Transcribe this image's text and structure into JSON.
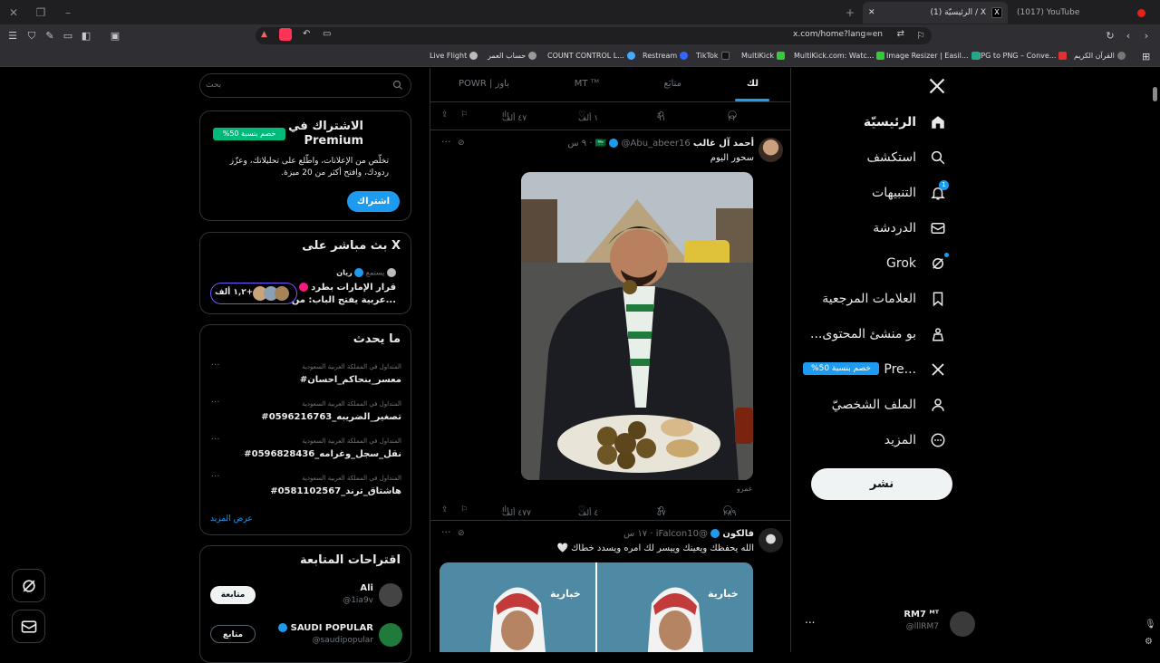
{
  "browser": {
    "tabs": [
      {
        "title": "(1017) YouTube",
        "active": false
      },
      {
        "title": "(1) الرئيسيّة / X",
        "active": true
      }
    ],
    "url": "x.com/home?lang=en",
    "bookmarks": [
      "القرآن الكريم",
      "JPG to PNG – Conve...",
      "Image Resizer | Easil...",
      "MultiKick.com: Watc...",
      "MultiKick",
      "TikTok",
      "Restream",
      "COUNT CONTROL L...",
      "حساب العمر",
      "Live Flight"
    ]
  },
  "nav": {
    "items": [
      {
        "label": "الرئيسيّة",
        "icon": "home-icon",
        "bold": true
      },
      {
        "label": "استكشف",
        "icon": "search-icon"
      },
      {
        "label": "التنبيهات",
        "icon": "bell-icon",
        "badge": "1"
      },
      {
        "label": "الدردشة",
        "icon": "mail-icon"
      },
      {
        "label": "Grok",
        "icon": "grok-icon"
      },
      {
        "label": "العلامات المرجعية",
        "icon": "bookmark-icon"
      },
      {
        "label": "...بو منشئ المحتوى",
        "icon": "creator-icon"
      },
      {
        "label": "Pre...",
        "icon": "x-logo-icon"
      },
      {
        "label": "الملف الشخصيّ",
        "icon": "person-icon"
      },
      {
        "label": "المزيد",
        "icon": "more-circle-icon"
      }
    ],
    "premium_badge": "%خصم بنسبة 50",
    "post_label": "نشر",
    "account": {
      "name": "RM7 ᴹᵀ",
      "handle": "@lllRM7",
      "more": "..."
    }
  },
  "feed": {
    "tabs": [
      "لك",
      "متابَع",
      "MT ᵀᴹ",
      "POWR | باور"
    ],
    "top_actions": {
      "replies": "٢٢",
      "reposts": "٩١",
      "likes": "١ ألف",
      "views": "٤٧ ألف"
    },
    "tweets": [
      {
        "name": "أحمد آل غالب",
        "flag": "🇸🇦",
        "handle": "@Abu_abeer16",
        "time": "· ٩ س",
        "text": "سحور اليوم",
        "caption": "غمرو",
        "actions": {
          "replies": "٢٨٩",
          "reposts": "٥٧",
          "likes": "٤ ألف",
          "views": "٤٧٧ ألف"
        }
      },
      {
        "name": "فالكون",
        "handle": "@iFalcon10",
        "time": "· ١٧ س",
        "text": "الله يحفظك ويعينك وييسر لك امره ويسدد خطاك 🤍",
        "image_label": "خبارية"
      }
    ]
  },
  "sidebar": {
    "search_placeholder": "بحث",
    "premium": {
      "title": "الاشتراك في Premium",
      "badge": "%خصم بنسبة 50",
      "body": "تخلّص من الإعلانات، واطّلع على تحليلاتك، وعزّز ردودك، وافتح أكثر من 20 ميزة.",
      "button": "اشتراك"
    },
    "live": {
      "title": "X بث مباشر على",
      "listening": "يستمع",
      "host": "ريان",
      "headline_1": "قرار الإمارات بطرد",
      "headline_2": "...عربية يفتح الباب: من",
      "count": "١,٢ ألف+"
    },
    "trends": {
      "title": "ما يحدث",
      "items": [
        {
          "meta": "المتداول في المملكة العربية السعودية",
          "name": "#معسر_بنحاكم_احسان"
        },
        {
          "meta": "المتداول في المملكة العربية السعودية",
          "name": "#تصغير_الضريبه_0596216763"
        },
        {
          "meta": "المتداول في المملكة العربية السعودية",
          "name": "#نقل_سجل_وغرامه_0596828436"
        },
        {
          "meta": "المتداول في المملكة العربية السعودية",
          "name": "#هاشتاق_ترند_0581102567"
        }
      ],
      "show_more": "عرض المزيد"
    },
    "follow": {
      "title": "اقتراحات المتابعة",
      "items": [
        {
          "name": "Ali",
          "handle": "@1ia9v",
          "button": "متابعة"
        },
        {
          "name": "SAUDI POPULAR",
          "handle": "@saudipopular",
          "button": "متابع"
        }
      ]
    }
  },
  "colors": {
    "accent": "#1d9bf0",
    "bg": "#000000",
    "border": "#2f3336",
    "muted": "#71767b"
  }
}
